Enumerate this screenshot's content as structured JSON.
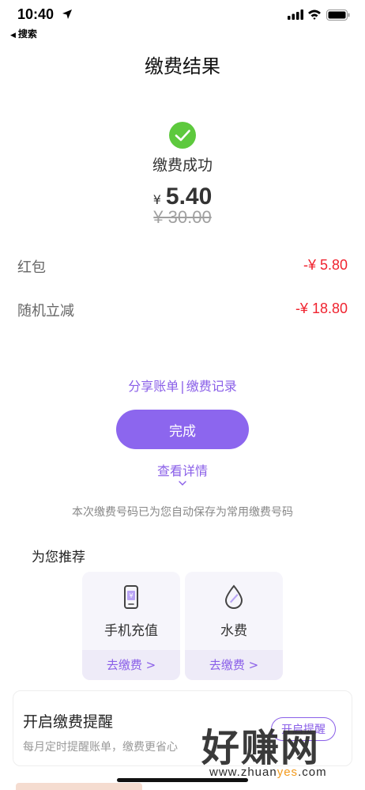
{
  "status_bar": {
    "time": "10:40",
    "back_label": "搜索"
  },
  "header": {
    "title": "缴费结果"
  },
  "result": {
    "status_text": "缴费成功",
    "currency": "¥",
    "amount": "5.40",
    "original_amount": "¥ 30.00"
  },
  "discounts": [
    {
      "label": "红包",
      "value": "-¥ 5.80"
    },
    {
      "label": "随机立减",
      "value": "-¥ 18.80"
    }
  ],
  "links": {
    "share": "分享账单",
    "separator": "|",
    "records": "缴费记录"
  },
  "done_button": "完成",
  "detail_link": "查看详情",
  "saved_note": "本次缴费号码已为您自动保存为常用缴费号码",
  "recommend": {
    "title": "为您推荐",
    "cards": [
      {
        "label": "手机充值",
        "action": "去缴费 >",
        "icon": "phone-recharge-icon"
      },
      {
        "label": "水费",
        "action": "去缴费 >",
        "icon": "water-drop-icon"
      }
    ]
  },
  "reminder": {
    "title": "开启缴费提醒",
    "subtitle": "每月定时提醒账单，缴费更省心",
    "button": "开启提醒"
  },
  "watermark": {
    "brand": "好赚网",
    "url_pre": "www.zhuan",
    "url_accent": "yes",
    "url_post": ".com"
  },
  "colors": {
    "accent": "#8c66ee",
    "success": "#5dc93d",
    "discount": "#f0232f"
  }
}
